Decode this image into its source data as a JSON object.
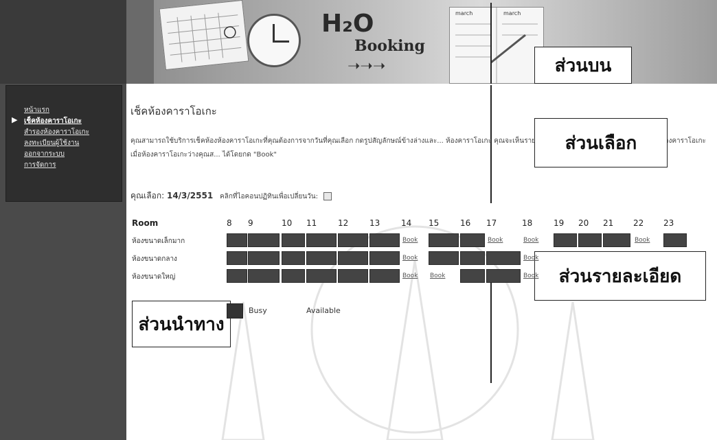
{
  "header": {
    "logo_main": "H₂O",
    "logo_sub": "Booking",
    "planner_col1": "march",
    "planner_col2": "march"
  },
  "annotations": {
    "top": "ส่วนบน",
    "select": "ส่วนเลือก",
    "detail": "ส่วนรายละเอียด",
    "nav": "ส่วนนำทาง"
  },
  "sidebar": {
    "items": [
      {
        "label": "หน้าแรก",
        "active": false
      },
      {
        "label": "เช็คห้องคาราโอเกะ",
        "active": true
      },
      {
        "label": "สำรองห้องคาราโอเกะ",
        "active": false
      },
      {
        "label": "ลงทะเบียนผู้ใช้งาน",
        "active": false
      },
      {
        "label": "ออกจากระบบ",
        "active": false
      },
      {
        "label": "การจัดการ",
        "active": false
      }
    ]
  },
  "main": {
    "title": "เช็คห้องคาราโอเกะ",
    "description": "คุณสามารถใช้บริการเช็คห้องห้องคาราโอเกะที่คุณต้องการจากวันที่คุณเลือก กดรูปสัญลักษณ์ข้างล่างและ... ห้องคาราโอเกะ คุณจะเห็นรายการสำรองห้องคาราโอเกะ และสถานะของห้องคาราโอเกะ เมื่อห้องคาราโอเกะว่างคุณส... ได้โดยกด \"Book\"",
    "date_prefix": "คุณเลือก:",
    "date_value": "14/3/2551",
    "date_hint": "คลิกที่ไอคอนปฏิทินเพื่อเปลี่ยนวัน:"
  },
  "schedule": {
    "room_header": "Room",
    "hours": [
      "8",
      "9",
      "10",
      "11",
      "12",
      "13",
      "14",
      "15",
      "16",
      "17",
      "18",
      "19",
      "20",
      "21",
      "22",
      "23"
    ],
    "book_label": "Book",
    "rooms": [
      {
        "name": "ห้องขนาดเล็กมาก",
        "slots": [
          "busy",
          "busy",
          "busy",
          "busy",
          "busy",
          "busy",
          "book",
          "busy",
          "busy",
          "book",
          "book",
          "busy",
          "busy",
          "busy",
          "book",
          "busy"
        ]
      },
      {
        "name": "ห้องขนาดกลาง",
        "slots": [
          "busy",
          "busy",
          "busy",
          "busy",
          "busy",
          "busy",
          "book",
          "busy",
          "busy",
          "busy",
          "book",
          "",
          "",
          "",
          "",
          ""
        ]
      },
      {
        "name": "ห้องขนาดใหญ่",
        "slots": [
          "busy",
          "busy",
          "busy",
          "busy",
          "busy",
          "busy",
          "book",
          "book",
          "busy",
          "busy",
          "book",
          "",
          "",
          "",
          "",
          ""
        ]
      }
    ]
  },
  "legend": {
    "busy": "Busy",
    "available": "Available"
  },
  "colors": {
    "busy": "#444444",
    "sidebar": "#4a4a4a",
    "nav_panel": "#2e2e2e"
  }
}
